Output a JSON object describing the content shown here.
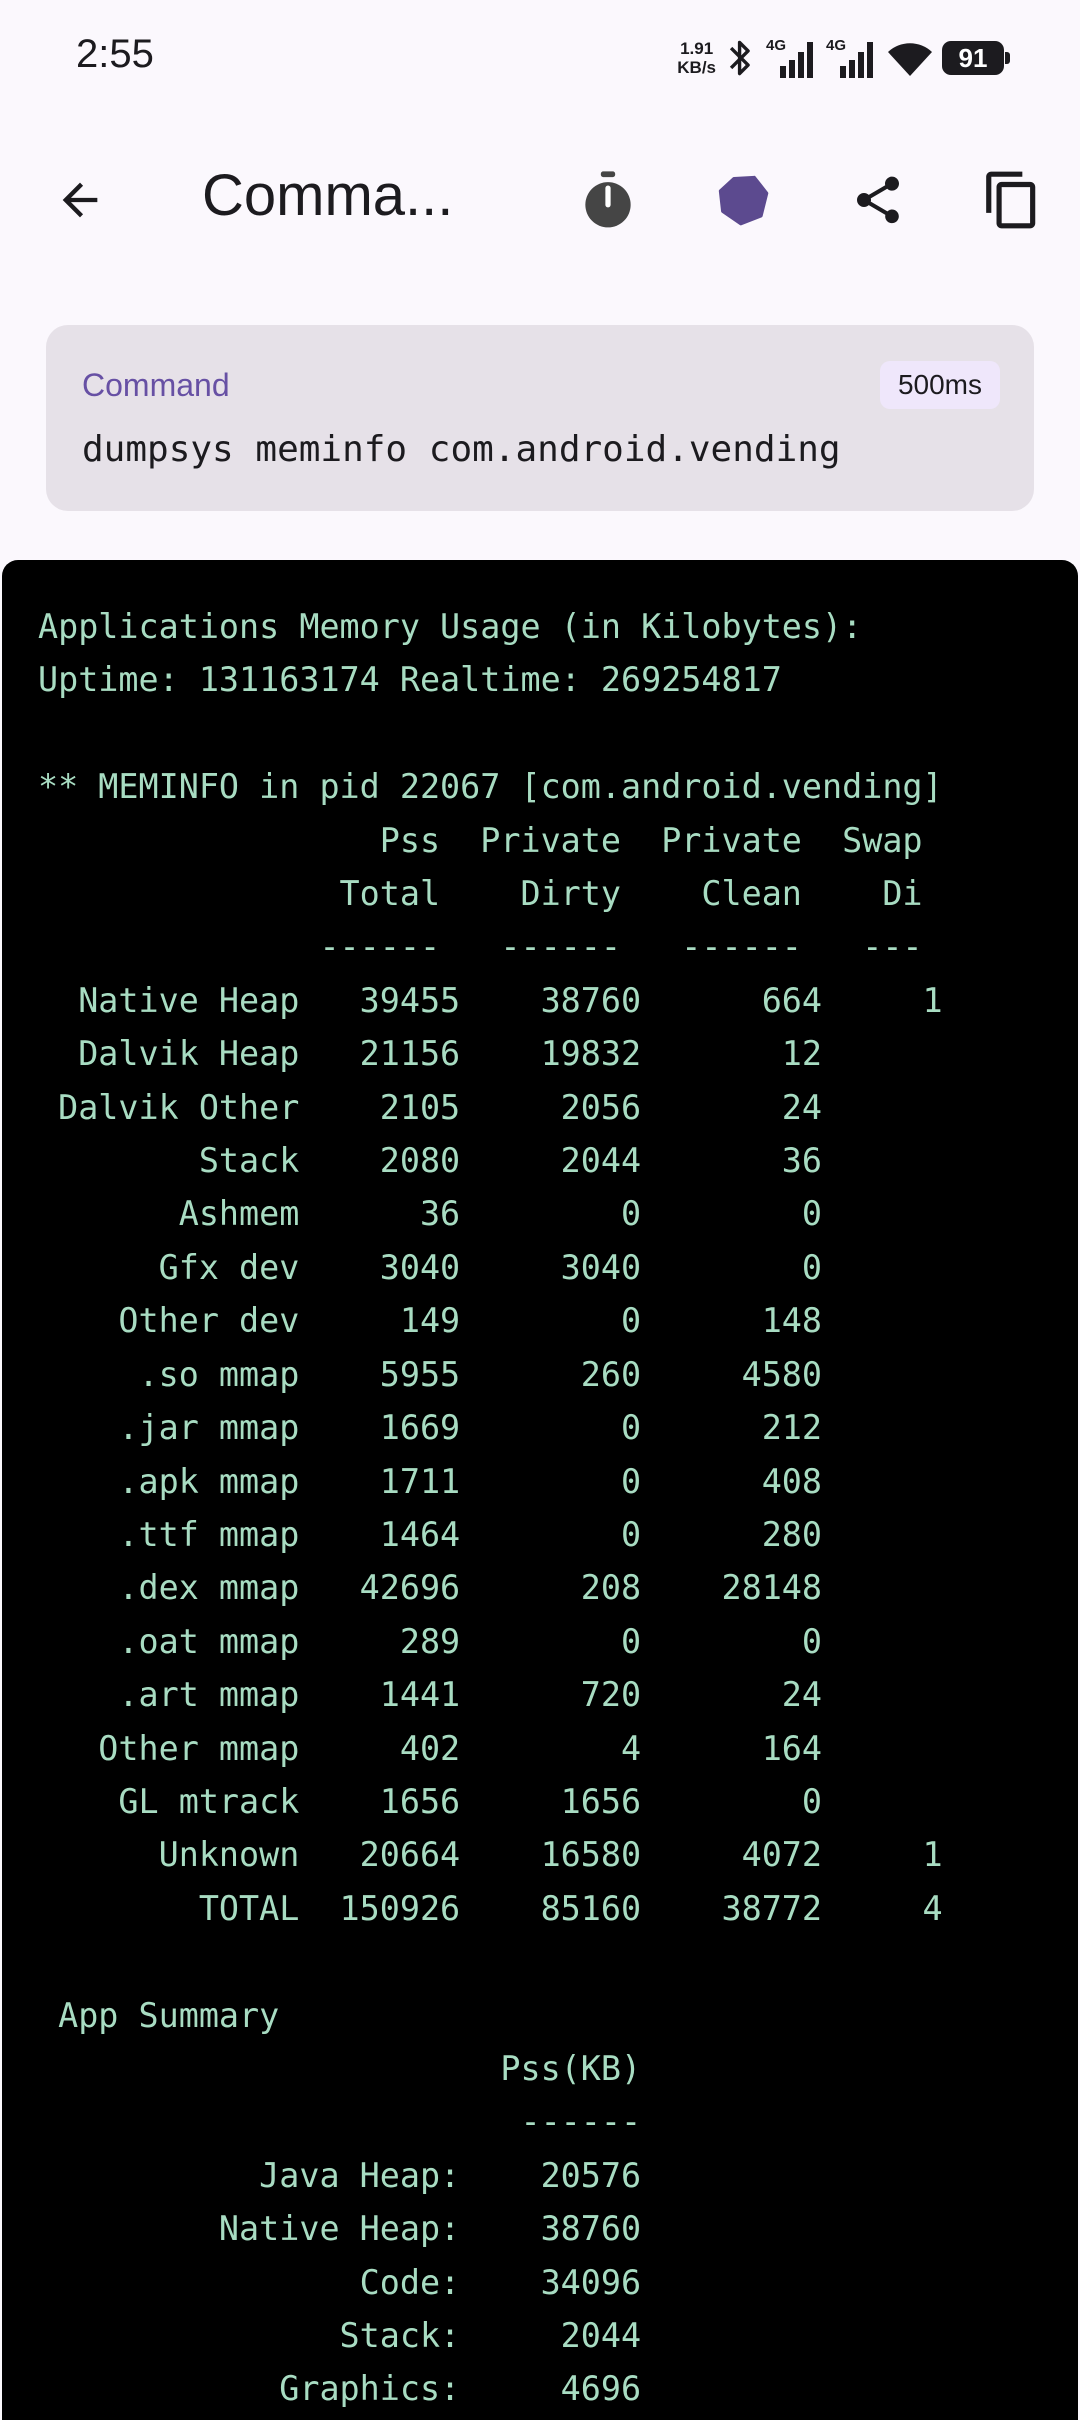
{
  "status_bar": {
    "time": "2:55",
    "net_speed_value": "1.91",
    "net_speed_unit": "KB/s",
    "net_type_1": "4G",
    "net_type_2": "4G",
    "battery": "91"
  },
  "app_bar": {
    "title": "Comma...",
    "icons": [
      "arrow-back-icon",
      "timer-icon",
      "theme-blob-icon",
      "share-icon",
      "copy-icon"
    ]
  },
  "command": {
    "label": "Command",
    "text": "dumpsys meminfo com.android.vending",
    "duration": "500ms"
  },
  "output": {
    "lines": [
      "Applications Memory Usage (in Kilobytes):",
      "Uptime: 131163174 Realtime: 269254817",
      "",
      "** MEMINFO in pid 22067 [com.android.vending]",
      "                 Pss  Private  Private  Swap",
      "               Total    Dirty    Clean    Di",
      "              ------   ------   ------   ---",
      "  Native Heap   39455    38760      664     1",
      "  Dalvik Heap   21156    19832       12",
      " Dalvik Other    2105     2056       24",
      "        Stack    2080     2044       36",
      "       Ashmem      36        0        0",
      "      Gfx dev    3040     3040        0",
      "    Other dev     149        0      148",
      "     .so mmap    5955      260     4580",
      "    .jar mmap    1669        0      212",
      "    .apk mmap    1711        0      408",
      "    .ttf mmap    1464        0      280",
      "    .dex mmap   42696      208    28148",
      "    .oat mmap     289        0        0",
      "    .art mmap    1441      720       24",
      "   Other mmap     402        4      164",
      "    GL mtrack    1656     1656        0",
      "      Unknown   20664    16580     4072     1",
      "        TOTAL  150926    85160    38772     4",
      "",
      " App Summary",
      "                       Pss(KB)",
      "                        ------",
      "           Java Heap:    20576",
      "         Native Heap:    38760",
      "                Code:    34096",
      "               Stack:     2044",
      "            Graphics:     4696"
    ]
  },
  "colors": {
    "background": "#fbf8fd",
    "accent": "#6750a4",
    "terminal_bg": "#000000",
    "terminal_text": "#a8dcc2"
  }
}
